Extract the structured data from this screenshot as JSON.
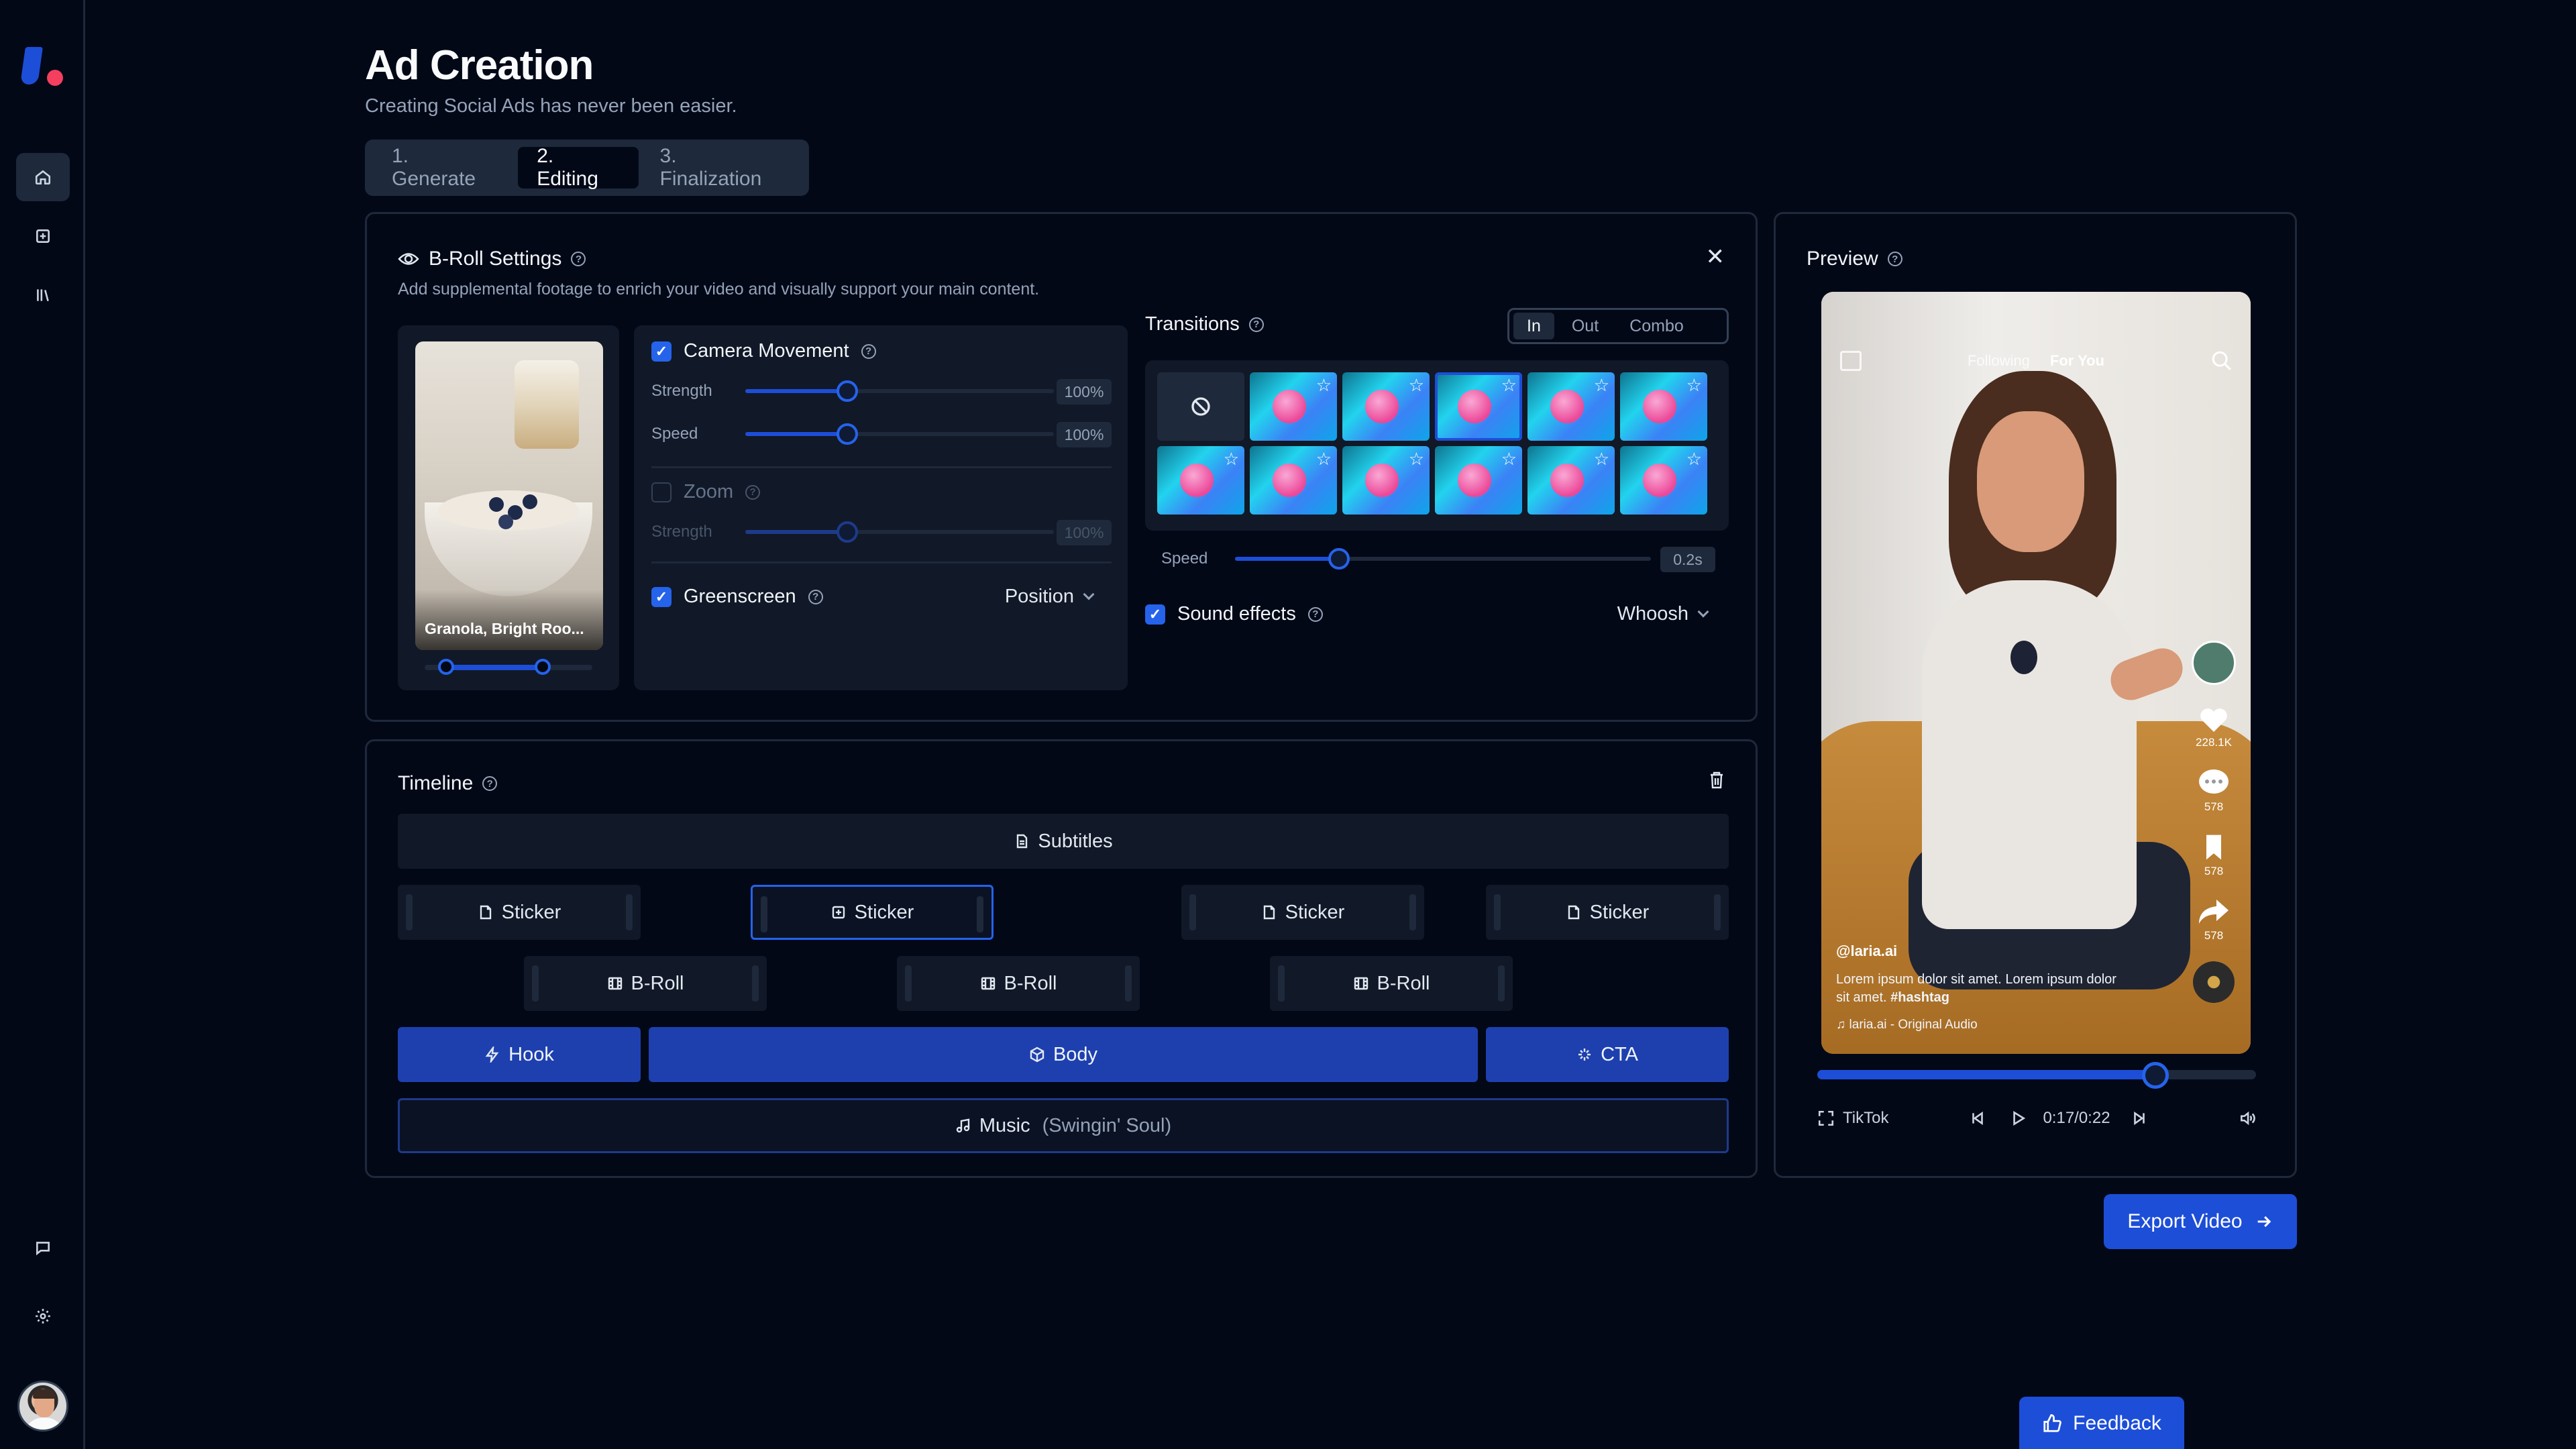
{
  "header": {
    "title": "Ad Creation",
    "subtitle": "Creating Social Ads has never been easier."
  },
  "steps": [
    {
      "label": "1. Generate",
      "active": false
    },
    {
      "label": "2. Editing",
      "active": true
    },
    {
      "label": "3. Finalization",
      "active": false
    }
  ],
  "sidebar": {
    "items": [
      {
        "icon": "home-icon",
        "active": true
      },
      {
        "icon": "plus-square-icon",
        "active": false
      },
      {
        "icon": "library-icon",
        "active": false
      }
    ],
    "bottom": [
      {
        "icon": "message-icon"
      },
      {
        "icon": "settings-icon"
      }
    ]
  },
  "broll": {
    "title": "B-Roll Settings",
    "description": "Add supplemental footage to enrich your video and visually support your main content.",
    "thumbnail_label": "Granola, Bright Roo...",
    "camera_movement": {
      "label": "Camera Movement",
      "checked": true,
      "strength_label": "Strength",
      "strength_value": "100%",
      "strength_level": 0.33,
      "speed_label": "Speed",
      "speed_value": "100%",
      "speed_level": 0.33
    },
    "zoom": {
      "label": "Zoom",
      "checked": false,
      "strength_label": "Strength",
      "strength_value": "100%",
      "strength_level": 0.33
    },
    "greenscreen": {
      "label": "Greenscreen",
      "checked": true,
      "dropdown": "Position"
    }
  },
  "transitions": {
    "title": "Transitions",
    "modes": [
      {
        "label": "In",
        "active": true
      },
      {
        "label": "Out",
        "active": false
      },
      {
        "label": "Combo",
        "active": false
      }
    ],
    "speed_label": "Speed",
    "speed_value": "0.2s",
    "speed_level": 0.25,
    "sound_effects": {
      "label": "Sound effects",
      "checked": true,
      "dropdown": "Whoosh"
    }
  },
  "timeline": {
    "title": "Timeline",
    "subtitles": "Subtitles",
    "stickers": [
      "Sticker",
      "Sticker",
      "Sticker",
      "Sticker"
    ],
    "brolls": [
      "B-Roll",
      "B-Roll",
      "B-Roll"
    ],
    "hook": "Hook",
    "body": "Body",
    "cta": "CTA",
    "music_label": "Music",
    "music_track": "(Swingin' Soul)"
  },
  "preview": {
    "title": "Preview",
    "tabs": [
      "Following",
      "For You"
    ],
    "username": "@laria.ai",
    "caption": "Lorem ipsum dolor sit amet. Lorem ipsum dolor sit amet.",
    "hashtag": "#hashtag",
    "audio": "laria.ai - Original Audio",
    "likes": "228.1K",
    "comments": "578",
    "saves": "578",
    "shares": "578",
    "platform": "TikTok",
    "time": "0:17/0:22",
    "progress": 0.77
  },
  "actions": {
    "export": "Export Video",
    "feedback": "Feedback"
  }
}
